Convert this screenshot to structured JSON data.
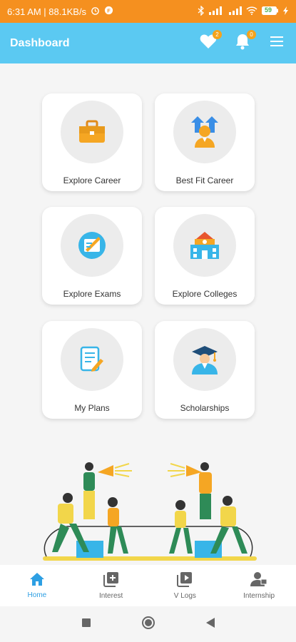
{
  "status_bar": {
    "time_speed": "6:31 AM | 88.1KB/s",
    "battery": "59"
  },
  "header": {
    "title": "Dashboard",
    "favorites_badge": "2",
    "notifications_badge": "0"
  },
  "tiles": [
    {
      "label": "Explore Career",
      "icon": "briefcase-icon"
    },
    {
      "label": "Best Fit Career",
      "icon": "career-growth-icon"
    },
    {
      "label": "Explore Exams",
      "icon": "exam-icon"
    },
    {
      "label": "Explore Colleges",
      "icon": "college-icon"
    },
    {
      "label": "My Plans",
      "icon": "plan-icon"
    },
    {
      "label": "Scholarships",
      "icon": "graduate-icon"
    }
  ],
  "bottom_nav": [
    {
      "label": "Home",
      "icon": "home-icon",
      "active": true
    },
    {
      "label": "Interest",
      "icon": "add-box-icon",
      "active": false
    },
    {
      "label": "V Logs",
      "icon": "video-icon",
      "active": false
    },
    {
      "label": "Internship",
      "icon": "person-icon",
      "active": false
    }
  ],
  "colors": {
    "status_bar": "#f5901f",
    "app_bar": "#5bc9f2",
    "accent": "#2d9fe3",
    "badge": "#f5a31c"
  }
}
